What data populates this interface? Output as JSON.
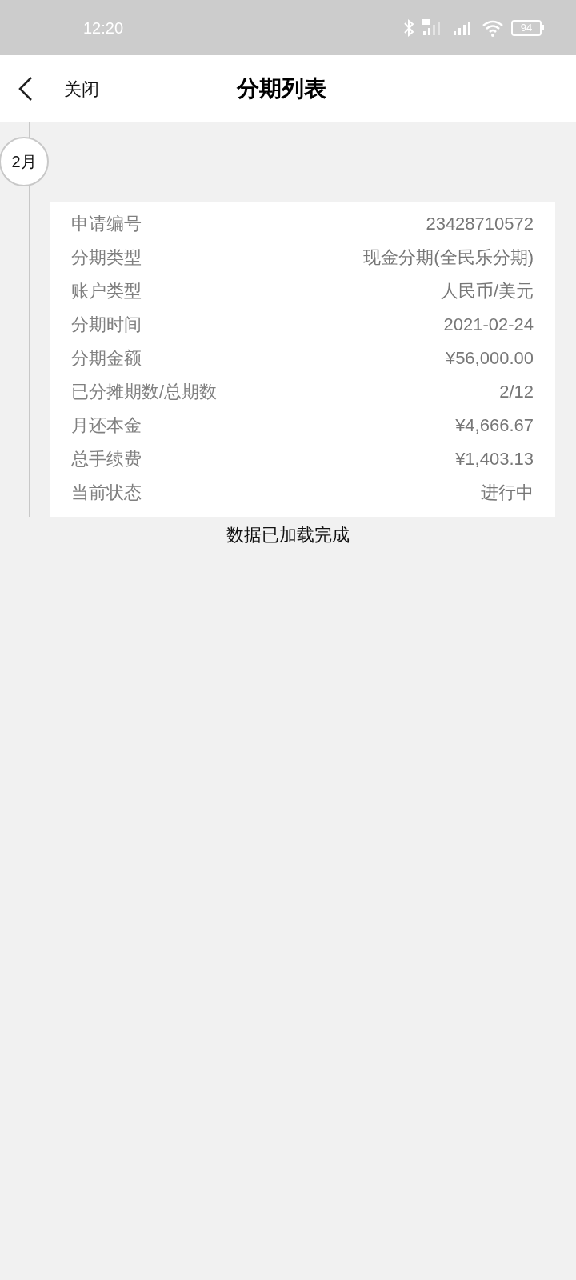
{
  "status_bar": {
    "time": "12:20",
    "battery": "94"
  },
  "header": {
    "back_label": "关闭",
    "title": "分期列表"
  },
  "timeline": {
    "month": "2月"
  },
  "card": {
    "rows": [
      {
        "label": "申请编号",
        "value": "23428710572"
      },
      {
        "label": "分期类型",
        "value": "现金分期(全民乐分期)"
      },
      {
        "label": "账户类型",
        "value": "人民币/美元"
      },
      {
        "label": "分期时间",
        "value": "2021-02-24"
      },
      {
        "label": "分期金额",
        "value": "¥56,000.00"
      },
      {
        "label": "已分摊期数/总期数",
        "value": "2/12"
      },
      {
        "label": "月还本金",
        "value": "¥4,666.67"
      },
      {
        "label": "总手续费",
        "value": "¥1,403.13"
      },
      {
        "label": "当前状态",
        "value": "进行中"
      }
    ]
  },
  "footer_message": "数据已加载完成"
}
